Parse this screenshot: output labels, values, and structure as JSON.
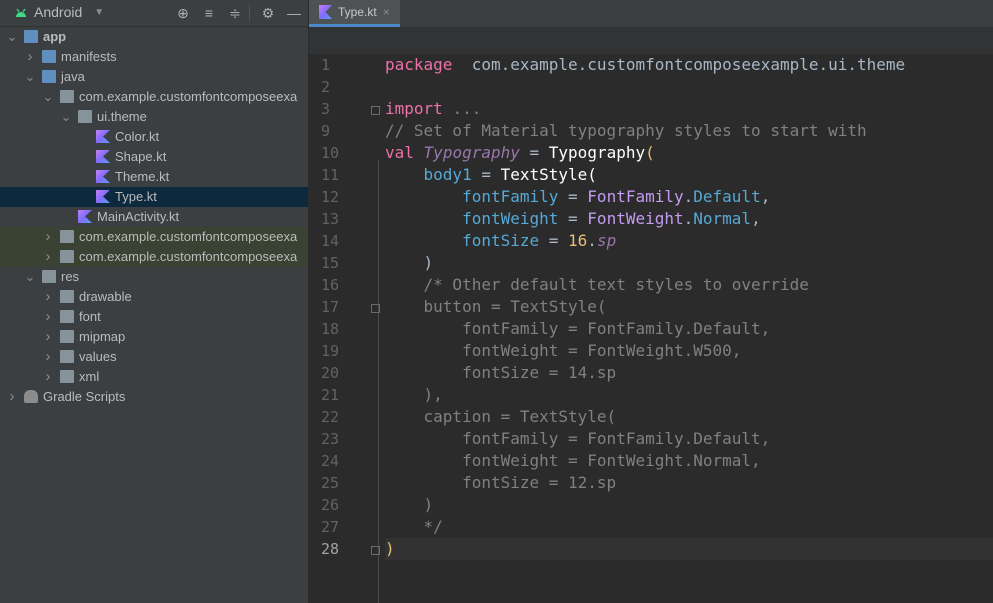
{
  "sidebar": {
    "project_view": "Android",
    "toolbar_icons": [
      "locate-icon",
      "expand-all-icon",
      "collapse-all-icon",
      "settings-icon",
      "minimize-icon"
    ],
    "tree": [
      {
        "label": "app",
        "level": 0,
        "expanded": true,
        "icon": "module-folder-icon",
        "bold": true
      },
      {
        "label": "manifests",
        "level": 1,
        "expanded": false,
        "icon": "folder-icon"
      },
      {
        "label": "java",
        "level": 1,
        "expanded": true,
        "icon": "folder-icon"
      },
      {
        "label": "com.example.customfontcomposeexa",
        "level": 2,
        "expanded": true,
        "icon": "package-icon"
      },
      {
        "label": "ui.theme",
        "level": 3,
        "expanded": true,
        "icon": "package-icon"
      },
      {
        "label": "Color.kt",
        "level": 4,
        "icon": "kotlin-file-icon"
      },
      {
        "label": "Shape.kt",
        "level": 4,
        "icon": "kotlin-file-icon"
      },
      {
        "label": "Theme.kt",
        "level": 4,
        "icon": "kotlin-file-icon"
      },
      {
        "label": "Type.kt",
        "level": 4,
        "icon": "kotlin-file-icon",
        "selected": true
      },
      {
        "label": "MainActivity.kt",
        "level": 3,
        "icon": "kotlin-file-icon"
      },
      {
        "label": "com.example.customfontcomposeexa",
        "level": 2,
        "expanded": false,
        "icon": "package-icon",
        "highlight": true
      },
      {
        "label": "com.example.customfontcomposeexa",
        "level": 2,
        "expanded": false,
        "icon": "package-icon",
        "highlight": true
      },
      {
        "label": "res",
        "level": 1,
        "expanded": true,
        "icon": "res-folder-icon"
      },
      {
        "label": "drawable",
        "level": 2,
        "expanded": false,
        "icon": "folder-icon"
      },
      {
        "label": "font",
        "level": 2,
        "expanded": false,
        "icon": "folder-icon"
      },
      {
        "label": "mipmap",
        "level": 2,
        "expanded": false,
        "icon": "folder-icon"
      },
      {
        "label": "values",
        "level": 2,
        "expanded": false,
        "icon": "folder-icon"
      },
      {
        "label": "xml",
        "level": 2,
        "expanded": false,
        "icon": "folder-icon"
      },
      {
        "label": "Gradle Scripts",
        "level": 0,
        "expanded": false,
        "icon": "gradle-icon"
      }
    ]
  },
  "editor": {
    "tab": {
      "label": "Type.kt",
      "close": "×"
    },
    "current_line": "28",
    "lines": [
      {
        "n": "1",
        "t": [
          [
            "kw2",
            "package"
          ],
          [
            "",
            "  com.example.customfontcomposeexample.ui.theme"
          ]
        ]
      },
      {
        "n": "2",
        "t": []
      },
      {
        "n": "3",
        "t": [
          [
            "kw2",
            "import"
          ],
          [
            "",
            " "
          ],
          [
            "cm",
            "..."
          ]
        ]
      },
      {
        "n": "9",
        "t": [
          [
            "cm",
            "// Set of Material typography styles to start with"
          ]
        ]
      },
      {
        "n": "10",
        "t": [
          [
            "kw2",
            "val"
          ],
          [
            "",
            " "
          ],
          [
            "fldit",
            "Typography"
          ],
          [
            "",
            " = "
          ],
          [
            "cls",
            "Typography"
          ],
          [
            "yel",
            "("
          ]
        ]
      },
      {
        "n": "11",
        "t": [
          [
            "",
            "    "
          ],
          [
            "cyan",
            "body1"
          ],
          [
            "",
            " = "
          ],
          [
            "cls",
            "TextStyle("
          ]
        ]
      },
      {
        "n": "12",
        "t": [
          [
            "",
            "        "
          ],
          [
            "cyan",
            "fontFamily"
          ],
          [
            "",
            " = "
          ],
          [
            "pur",
            "FontFamily"
          ],
          [
            "",
            "."
          ],
          [
            "cyan",
            "Default"
          ],
          [
            "",
            ","
          ]
        ]
      },
      {
        "n": "13",
        "t": [
          [
            "",
            "        "
          ],
          [
            "cyan",
            "fontWeight"
          ],
          [
            "",
            " = "
          ],
          [
            "pur",
            "FontWeight"
          ],
          [
            "",
            "."
          ],
          [
            "cyan",
            "Normal"
          ],
          [
            "",
            ","
          ]
        ]
      },
      {
        "n": "14",
        "t": [
          [
            "",
            "        "
          ],
          [
            "cyan",
            "fontSize"
          ],
          [
            "",
            " = "
          ],
          [
            "yel",
            "16"
          ],
          [
            "",
            "."
          ],
          [
            "fldit",
            "sp"
          ]
        ]
      },
      {
        "n": "15",
        "t": [
          [
            "",
            "    )"
          ]
        ]
      },
      {
        "n": "16",
        "t": [
          [
            "",
            "    "
          ],
          [
            "cm",
            "/* Other default text styles to override"
          ]
        ]
      },
      {
        "n": "17",
        "t": [
          [
            "cm",
            "    button = TextStyle("
          ]
        ]
      },
      {
        "n": "18",
        "t": [
          [
            "cm",
            "        fontFamily = FontFamily.Default,"
          ]
        ]
      },
      {
        "n": "19",
        "t": [
          [
            "cm",
            "        fontWeight = FontWeight.W500,"
          ]
        ]
      },
      {
        "n": "20",
        "t": [
          [
            "cm",
            "        fontSize = 14.sp"
          ]
        ]
      },
      {
        "n": "21",
        "t": [
          [
            "cm",
            "    ),"
          ]
        ]
      },
      {
        "n": "22",
        "t": [
          [
            "cm",
            "    caption = TextStyle("
          ]
        ]
      },
      {
        "n": "23",
        "t": [
          [
            "cm",
            "        fontFamily = FontFamily.Default,"
          ]
        ]
      },
      {
        "n": "24",
        "t": [
          [
            "cm",
            "        fontWeight = FontWeight.Normal,"
          ]
        ]
      },
      {
        "n": "25",
        "t": [
          [
            "cm",
            "        fontSize = 12.sp"
          ]
        ]
      },
      {
        "n": "26",
        "t": [
          [
            "cm",
            "    )"
          ]
        ]
      },
      {
        "n": "27",
        "t": [
          [
            "cm",
            "    */"
          ]
        ]
      },
      {
        "n": "28",
        "t": [
          [
            "yel",
            ")"
          ]
        ]
      }
    ]
  }
}
